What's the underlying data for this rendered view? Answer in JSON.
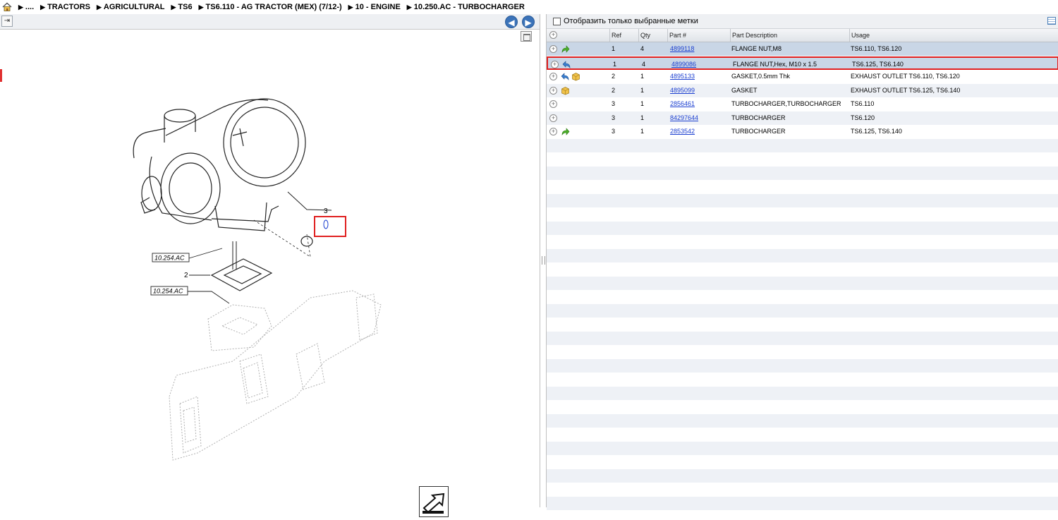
{
  "breadcrumb": {
    "items": [
      "....",
      "TRACTORS",
      "AGRICULTURAL",
      "TS6",
      "TS6.110 - AG TRACTOR (MEX) (7/12-)",
      "10 - ENGINE",
      "10.250.AC - TURBOCHARGER"
    ]
  },
  "diagram": {
    "callouts": {
      "ref3": "3",
      "ref1": "1",
      "ref2": "2",
      "ref_a": "10.254.AC",
      "ref_b": "10.254.AC"
    }
  },
  "parts_panel": {
    "filter_label": "Отобразить только выбранные метки",
    "columns": [
      "Ref",
      "Qty",
      "Part #",
      "Part Description",
      "Usage"
    ],
    "rows": [
      {
        "ref": "1",
        "qty": "4",
        "part": "4899118",
        "desc": "FLANGE NUT,M8",
        "usage": "TS6.110, TS6.120",
        "icons": [
          "green-arrow-icon"
        ]
      },
      {
        "ref": "1",
        "qty": "4",
        "part": "4899086",
        "desc": "FLANGE NUT,Hex, M10 x 1.5",
        "usage": "TS6.125, TS6.140",
        "icons": [
          "blue-arrow-icon"
        ]
      },
      {
        "ref": "2",
        "qty": "1",
        "part": "4895133",
        "desc": "GASKET,0.5mm Thk",
        "usage": "EXHAUST OUTLET TS6.110, TS6.120",
        "icons": [
          "blue-arrow-icon",
          "box-icon"
        ]
      },
      {
        "ref": "2",
        "qty": "1",
        "part": "4895099",
        "desc": "GASKET",
        "usage": "EXHAUST OUTLET TS6.125, TS6.140",
        "icons": [
          "box-icon"
        ]
      },
      {
        "ref": "3",
        "qty": "1",
        "part": "2856461",
        "desc": "TURBOCHARGER,TURBOCHARGER",
        "usage": "TS6.110",
        "icons": []
      },
      {
        "ref": "3",
        "qty": "1",
        "part": "84297644",
        "desc": "TURBOCHARGER",
        "usage": "TS6.120",
        "icons": []
      },
      {
        "ref": "3",
        "qty": "1",
        "part": "2853542",
        "desc": "TURBOCHARGER",
        "usage": "TS6.125, TS6.140",
        "icons": [
          "green-arrow-icon"
        ]
      }
    ]
  },
  "colors": {
    "highlight_border": "#e02020",
    "selected_row": "#c9d6e6",
    "link": "#1a3ed0"
  }
}
